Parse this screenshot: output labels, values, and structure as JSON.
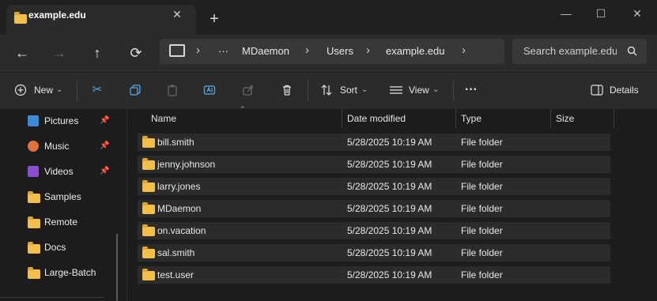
{
  "tab": {
    "title": "example.edu",
    "close_icon": "close-icon",
    "new_tab": "+"
  },
  "window": {
    "minimize": "—",
    "maximize": "☐",
    "close": "✕"
  },
  "nav": {
    "back": "←",
    "forward": "→",
    "up": "↑",
    "refresh": "⟳"
  },
  "breadcrumb": {
    "ellipsis": "···",
    "items": [
      "MDaemon",
      "Users",
      "example.edu"
    ],
    "sep": "›"
  },
  "search": {
    "placeholder": "Search example.edu"
  },
  "toolbar": {
    "new_label": "New",
    "sort_label": "Sort",
    "view_label": "View",
    "more": "···",
    "details_label": "Details"
  },
  "sidebar": {
    "items": [
      {
        "label": "Pictures",
        "icon": "pictures-icon",
        "pinned": true
      },
      {
        "label": "Music",
        "icon": "music-icon",
        "pinned": true
      },
      {
        "label": "Videos",
        "icon": "videos-icon",
        "pinned": true
      },
      {
        "label": "Samples",
        "icon": "folder-icon",
        "pinned": false
      },
      {
        "label": "Remote",
        "icon": "folder-icon",
        "pinned": false
      },
      {
        "label": "Docs",
        "icon": "folder-icon",
        "pinned": false
      },
      {
        "label": "Large-Batch",
        "icon": "folder-icon",
        "pinned": false
      }
    ]
  },
  "columns": {
    "name": "Name",
    "date": "Date modified",
    "type": "Type",
    "size": "Size"
  },
  "files": [
    {
      "name": "bill.smith",
      "date": "5/28/2025 10:19 AM",
      "type": "File folder"
    },
    {
      "name": "jenny.johnson",
      "date": "5/28/2025 10:19 AM",
      "type": "File folder"
    },
    {
      "name": "larry.jones",
      "date": "5/28/2025 10:19 AM",
      "type": "File folder"
    },
    {
      "name": "MDaemon",
      "date": "5/28/2025 10:19 AM",
      "type": "File folder"
    },
    {
      "name": "on.vacation",
      "date": "5/28/2025 10:19 AM",
      "type": "File folder"
    },
    {
      "name": "sal.smith",
      "date": "5/28/2025 10:19 AM",
      "type": "File folder"
    },
    {
      "name": "test.user",
      "date": "5/28/2025 10:19 AM",
      "type": "File folder"
    }
  ],
  "colors": {
    "folder": "#f2c04a",
    "accent": "#4cc2ff"
  }
}
